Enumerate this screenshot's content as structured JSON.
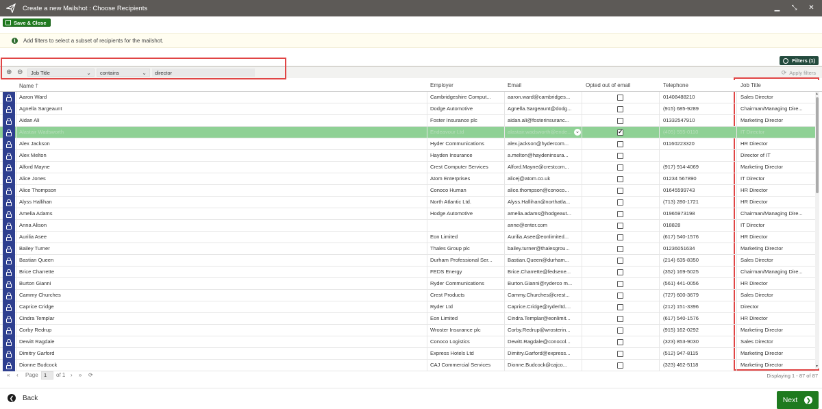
{
  "window": {
    "title": "Create a new Mailshot : Choose Recipients",
    "controls": [
      "minimize-icon",
      "restore-icon",
      "close-icon"
    ]
  },
  "toolbar": {
    "save_label": "Save & Close"
  },
  "info": {
    "message": "Add filters to select a subset of recipients for the mailshot."
  },
  "filters": {
    "button_label": "Filters (1)",
    "field": "Job Title",
    "operator": "contains",
    "value": "director",
    "apply_label": "Apply filters"
  },
  "grid": {
    "headers": {
      "name": "Name",
      "employer": "Employer",
      "email": "Email",
      "opted_out": "Opted out of email",
      "telephone": "Telephone",
      "job_title": "Job Title"
    },
    "rows": [
      {
        "name": "Aaron Ward",
        "employer": "Cambridgeshire Comput...",
        "email": "aaron.ward@cambridges...",
        "opted_out": false,
        "telephone": "01408488210",
        "job_title": "Sales Director"
      },
      {
        "name": "Agnella Sargeaunt",
        "employer": "Dodge Automotive",
        "email": "Agnella.Sargeaunt@dodg...",
        "opted_out": false,
        "telephone": "(915) 685-9289",
        "job_title": "Chairman/Managing Dire..."
      },
      {
        "name": "Aidan Ali",
        "employer": "Foster Insurance plc",
        "email": "aidan.ali@fosterinsuranc...",
        "opted_out": false,
        "telephone": "01332547910",
        "job_title": "Marketing Director"
      },
      {
        "name": "Alastair Wadsworth",
        "employer": "Endeavour Ltd",
        "email": "alastair.wadsworth@ende...",
        "opted_out": true,
        "telephone": "(405) 555-0110",
        "job_title": "IT Director",
        "selected": true
      },
      {
        "name": "Alex Jackson",
        "employer": "Hyder Communications",
        "email": "alex.jackson@hydercom...",
        "opted_out": false,
        "telephone": "01160223320",
        "job_title": "HR Director"
      },
      {
        "name": "Alex Melton",
        "employer": "Hayden Insurance",
        "email": "a.melton@haydeninsura...",
        "opted_out": false,
        "telephone": "",
        "job_title": "Director of IT"
      },
      {
        "name": "Alford Mayne",
        "employer": "Crest Computer Services",
        "email": "Alford.Mayne@crestcom...",
        "opted_out": false,
        "telephone": "(917) 914-4069",
        "job_title": "Marketing Director"
      },
      {
        "name": "Alice Jones",
        "employer": "Atom Enterprises",
        "email": "alicej@atom.co.uk",
        "opted_out": false,
        "telephone": "01234 567890",
        "job_title": "IT Director"
      },
      {
        "name": "Alice Thompson",
        "employer": "Conoco Human",
        "email": "alice.thompson@conoco...",
        "opted_out": false,
        "telephone": "01645599743",
        "job_title": "HR Director"
      },
      {
        "name": "Alyss Hallihan",
        "employer": "North Atlantic Ltd.",
        "email": "Alyss.Hallihan@northatla...",
        "opted_out": false,
        "telephone": "(713) 280-1721",
        "job_title": "HR Director"
      },
      {
        "name": "Amelia Adams",
        "employer": "Hodge Automotive",
        "email": "amelia.adams@hodgeaut...",
        "opted_out": false,
        "telephone": "01965973198",
        "job_title": "Chairman/Managing Dire..."
      },
      {
        "name": "Anna Alison",
        "employer": "",
        "email": "anne@enter.com",
        "opted_out": false,
        "telephone": "018828",
        "job_title": "IT Director"
      },
      {
        "name": "Aurilia Asee",
        "employer": "Eon Limited",
        "email": "Aurilia.Asee@eonlimited...",
        "opted_out": false,
        "telephone": "(617) 540-1576",
        "job_title": "HR Director"
      },
      {
        "name": "Bailey Turner",
        "employer": "Thales Group plc",
        "email": "bailey.turner@thalesgrou...",
        "opted_out": false,
        "telephone": "01236051634",
        "job_title": "Marketing Director"
      },
      {
        "name": "Bastian Queen",
        "employer": "Durham Professional Ser...",
        "email": "Bastian.Queen@durham...",
        "opted_out": false,
        "telephone": "(214) 635-8350",
        "job_title": "Sales Director"
      },
      {
        "name": "Brice Charrette",
        "employer": "FEDS Energy",
        "email": "Brice.Charrette@fedsene...",
        "opted_out": false,
        "telephone": "(352) 169-5025",
        "job_title": "Chairman/Managing Dire..."
      },
      {
        "name": "Burton Gianni",
        "employer": "Ryder Communications",
        "email": "Burton.Gianni@ryderco m...",
        "opted_out": false,
        "telephone": "(561) 441-0056",
        "job_title": "HR Director"
      },
      {
        "name": "Cammy Churches",
        "employer": "Crest Products",
        "email": "Cammy.Churches@crest...",
        "opted_out": false,
        "telephone": "(727) 600-3679",
        "job_title": "Sales Director"
      },
      {
        "name": "Caprice Cridge",
        "employer": "Ryder Ltd",
        "email": "Caprice.Cridge@ryderltd....",
        "opted_out": false,
        "telephone": "(212) 151-3396",
        "job_title": "Director"
      },
      {
        "name": "Cindra Templar",
        "employer": "Eon Limited",
        "email": "Cindra.Templar@eonlimit...",
        "opted_out": false,
        "telephone": "(617) 540-1576",
        "job_title": "HR Director"
      },
      {
        "name": "Corby Redrup",
        "employer": "Wroster Insurance plc",
        "email": "Corby.Redrup@wrosterin...",
        "opted_out": false,
        "telephone": "(915) 162-0292",
        "job_title": "Marketing Director"
      },
      {
        "name": "Dewitt Ragdale",
        "employer": "Conoco Logistics",
        "email": "Dewitt.Ragdale@conocol...",
        "opted_out": false,
        "telephone": "(323) 853-9030",
        "job_title": "Sales Director"
      },
      {
        "name": "Dimitry Garford",
        "employer": "Express Hotels Ltd",
        "email": "Dimitry.Garford@express...",
        "opted_out": false,
        "telephone": "(512) 947-8115",
        "job_title": "Marketing Director"
      },
      {
        "name": "Dionne Budcock",
        "employer": "CAJ Commercial Services",
        "email": "Dionne.Budcock@cajco...",
        "opted_out": false,
        "telephone": "(323) 462-5118",
        "job_title": "Marketing Director"
      }
    ]
  },
  "pager": {
    "page_label": "Page",
    "page_value": "1",
    "of_label": "of 1",
    "displaying": "Displaying 1 - 87 of 87"
  },
  "footer": {
    "back_label": "Back",
    "next_label": "Next"
  }
}
